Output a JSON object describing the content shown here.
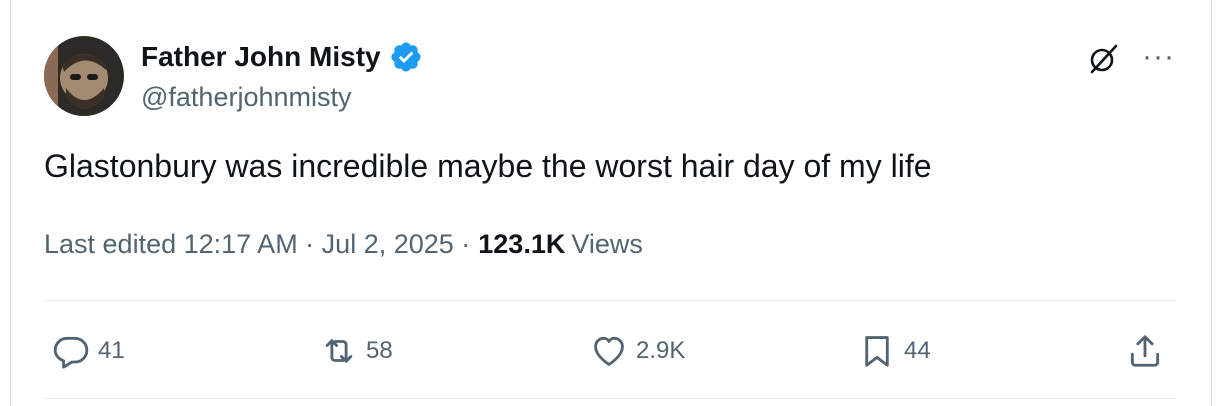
{
  "author": {
    "name": "Father John Misty",
    "handle": "@fatherjohnmisty",
    "verified": true
  },
  "tweet": {
    "text": "Glastonbury was incredible maybe the worst hair day of my life"
  },
  "meta": {
    "edited_label": "Last edited 12:17 AM · Jul 2, 2025 ·",
    "views_count": "123.1K",
    "views_label": "Views"
  },
  "actions": {
    "replies": "41",
    "reposts": "58",
    "likes": "2.9K",
    "bookmarks": "44"
  },
  "icons": {
    "verified": "verified-badge-icon",
    "grok": "grok-icon",
    "more": "more-icon",
    "reply": "reply-icon",
    "repost": "repost-icon",
    "like": "heart-icon",
    "bookmark": "bookmark-icon",
    "share": "share-icon"
  },
  "colors": {
    "verified": "#1d9bf0",
    "secondary_text": "#536471",
    "primary_text": "#0f1419"
  }
}
